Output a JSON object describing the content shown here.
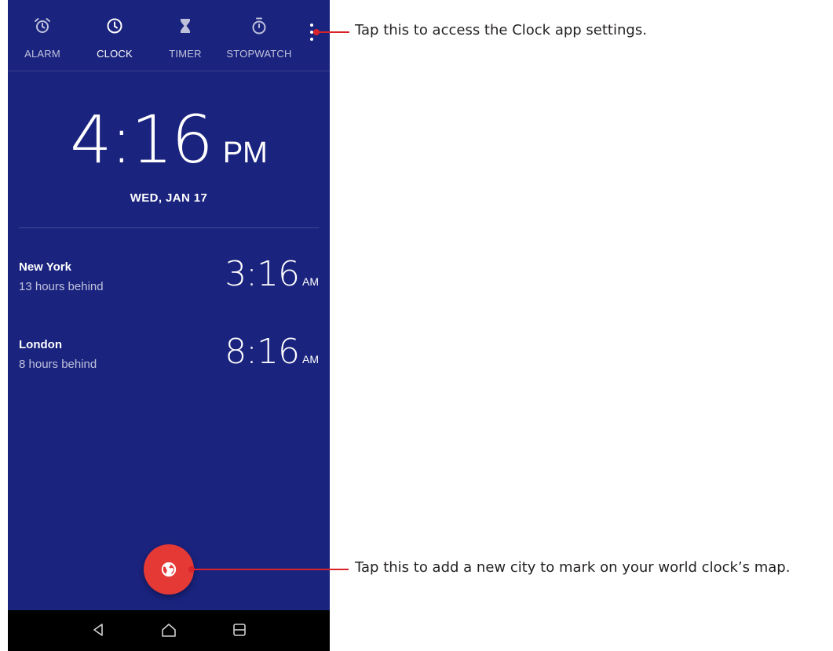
{
  "tabs": [
    {
      "label": "ALARM",
      "icon": "alarm-icon",
      "active": false
    },
    {
      "label": "CLOCK",
      "icon": "clock-icon",
      "active": true
    },
    {
      "label": "TIMER",
      "icon": "timer-icon",
      "active": false
    },
    {
      "label": "STOPWATCH",
      "icon": "stopwatch-icon",
      "active": false
    }
  ],
  "overflow_menu": {
    "icon": "more-vert-icon"
  },
  "main_clock": {
    "time": "4:16",
    "ampm": "PM",
    "date": "WED, JAN 17"
  },
  "cities": [
    {
      "name": "New York",
      "offset": "13 hours behind",
      "time": "3:16",
      "ampm": "AM"
    },
    {
      "name": "London",
      "offset": "8 hours behind",
      "time": "8:16",
      "ampm": "AM"
    }
  ],
  "fab": {
    "icon": "globe-icon"
  },
  "navbar": {
    "back_icon": "back-icon",
    "home_icon": "home-icon",
    "recents_icon": "recents-icon"
  },
  "annotations": {
    "settings": "Tap this to access the Clock app settings.",
    "add_city": "Tap this to add a new city to mark on your world clock’s map."
  },
  "colors": {
    "background": "#1a237e",
    "fab": "#e53935",
    "callout": "#d8232a",
    "navbar": "#000000"
  }
}
